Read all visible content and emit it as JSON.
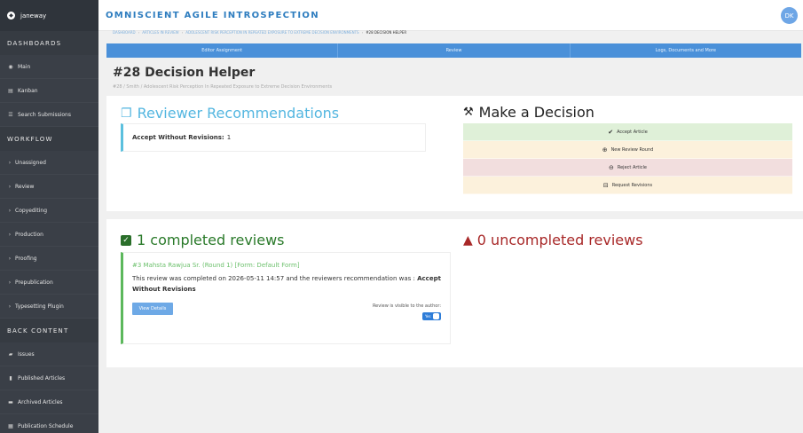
{
  "sidebar": {
    "brand": "janeway",
    "sections": {
      "dashboards": "DASHBOARDS",
      "workflow": "WORKFLOW",
      "back_content": "BACK CONTENT"
    },
    "items": {
      "main": "Main",
      "kanban": "Kanban",
      "search": "Search Submissions",
      "unassigned": "Unassigned",
      "review": "Review",
      "copyediting": "Copyediting",
      "production": "Production",
      "proofing": "Proofing",
      "prepublication": "Prepublication",
      "typesetting": "Typesetting Plugin",
      "issues": "Issues",
      "published": "Published Articles",
      "archived": "Archived Articles",
      "schedule": "Publication Schedule"
    }
  },
  "header": {
    "title": "OMNISCIENT AGILE INTROSPECTION",
    "avatar_initials": "DK"
  },
  "breadcrumb": {
    "dashboard": "DASHBOARD",
    "articles": "ARTICLES IN REVIEW",
    "article": "ADOLESCENT RISK PERCEPTION IN REPEATED EXPOSURE TO EXTREME DECISION ENVIRONMENTS",
    "current": "#28 DECISION HELPER"
  },
  "tabs": {
    "editor": "Editor Assignment",
    "review": "Review",
    "logs": "Logs, Documents and More"
  },
  "page": {
    "title": "#28 Decision Helper",
    "subtitle": "#28 / Smith / Adolescent Risk Perception In Repeated Exposure to Extreme Decision Environments"
  },
  "recommendations": {
    "heading": "Reviewer Recommendations",
    "label": "Accept Without Revisions",
    "count": "1"
  },
  "decision": {
    "heading": "Make a Decision",
    "accept": "Accept Article",
    "new_round": "New Review Round",
    "reject": "Reject Article",
    "revisions": "Request Revisions"
  },
  "completed": {
    "heading": "1 completed reviews",
    "review_title": "#3 Mahsta Rawjua Sr. (Round 1) [Form: Default Form]",
    "text_prefix": "This review was completed on 2026-05-11 14:57 and the reviewers recommendation was : ",
    "recommendation": "Accept Without Revisions",
    "view_button": "View Details",
    "visible_label": "Review is visible to the author:",
    "toggle_label": "Yes"
  },
  "uncompleted": {
    "heading": "0 uncompleted reviews"
  }
}
